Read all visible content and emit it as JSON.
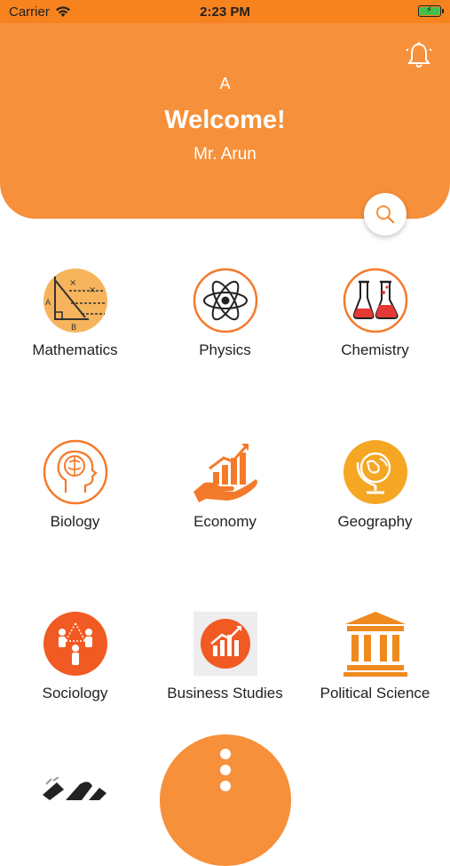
{
  "status_bar": {
    "carrier": "Carrier",
    "time": "2:23 PM",
    "battery_icon": "battery-charging-icon"
  },
  "header": {
    "avatar_initial": "A",
    "welcome": "Welcome!",
    "user_name": "Mr. Arun",
    "bell_icon": "bell-icon",
    "search_icon": "search-icon"
  },
  "subjects": [
    {
      "label": "Mathematics",
      "icon": "mathematics-icon"
    },
    {
      "label": "Physics",
      "icon": "atom-icon"
    },
    {
      "label": "Chemistry",
      "icon": "flasks-icon"
    },
    {
      "label": "Biology",
      "icon": "brain-head-icon"
    },
    {
      "label": "Economy",
      "icon": "growth-hand-icon"
    },
    {
      "label": "Geography",
      "icon": "globe-icon"
    },
    {
      "label": "Sociology",
      "icon": "people-network-icon"
    },
    {
      "label": "Business Studies",
      "icon": "business-chart-icon"
    },
    {
      "label": "Political Science",
      "icon": "pillars-building-icon"
    }
  ],
  "colors": {
    "brand_orange": "#f7903a",
    "status_orange": "#f7831f",
    "dark_orange": "#f15a22"
  }
}
